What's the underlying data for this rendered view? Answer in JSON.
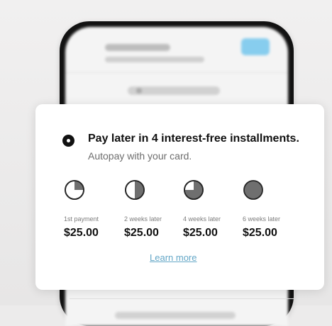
{
  "payment_card": {
    "headline": "Pay later in 4 interest-free installments.",
    "subheadline": "Autopay with your card.",
    "learn_more": "Learn more",
    "installments": [
      {
        "label": "1st payment",
        "amount": "$25.00",
        "icon": "quarter-pie-icon"
      },
      {
        "label": "2 weeks later",
        "amount": "$25.00",
        "icon": "half-pie-icon"
      },
      {
        "label": "4 weeks later",
        "amount": "$25.00",
        "icon": "three-quarter-pie-icon"
      },
      {
        "label": "6 weeks later",
        "amount": "$25.00",
        "icon": "full-pie-icon"
      }
    ]
  },
  "colors": {
    "link": "#64a7c7",
    "phone_button": "#87cdee"
  }
}
